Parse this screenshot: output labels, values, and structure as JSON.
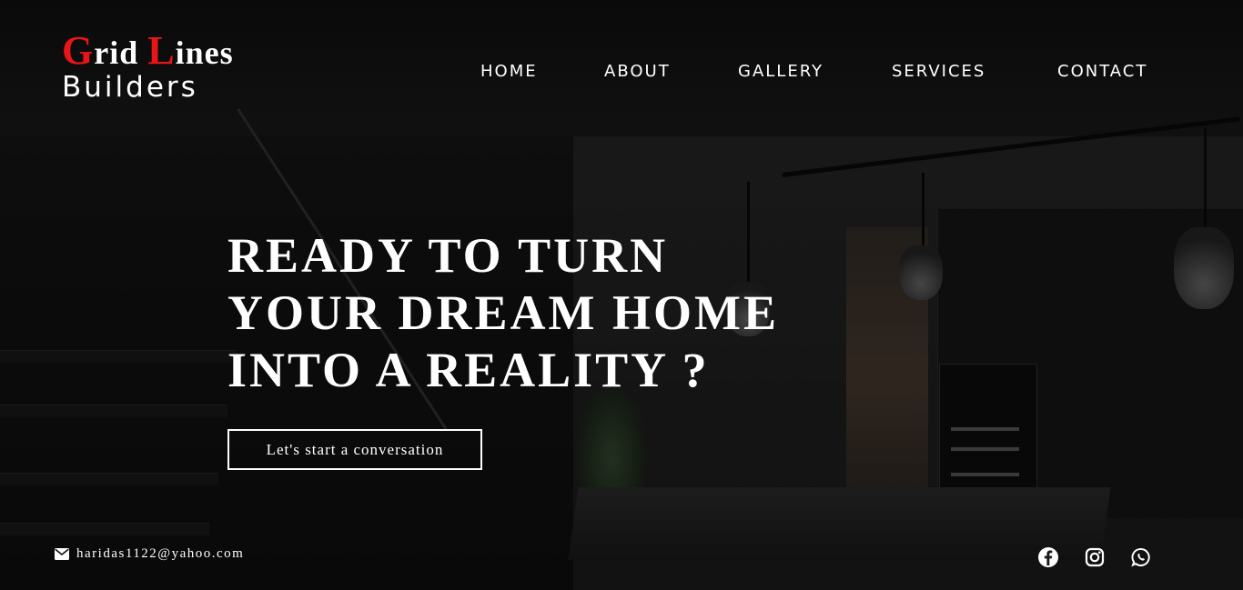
{
  "brand": {
    "g_cap": "G",
    "g_rest": "rid ",
    "l_cap": "L",
    "l_rest": "ines",
    "subtitle": "Builders",
    "accent_color": "#e81616"
  },
  "nav": {
    "items": [
      {
        "label": "HOME"
      },
      {
        "label": "ABOUT"
      },
      {
        "label": "GALLERY"
      },
      {
        "label": "SERVICES"
      },
      {
        "label": "CONTACT"
      }
    ]
  },
  "hero": {
    "lines": [
      "READY TO TURN",
      "YOUR DREAM HOME",
      "INTO A REALITY ?"
    ],
    "cta_label": "Let's start a conversation"
  },
  "contact": {
    "email_icon": "envelope-icon",
    "email": "haridas1122@yahoo.com"
  },
  "social": {
    "icons": [
      "facebook-icon",
      "instagram-icon",
      "whatsapp-icon"
    ]
  }
}
